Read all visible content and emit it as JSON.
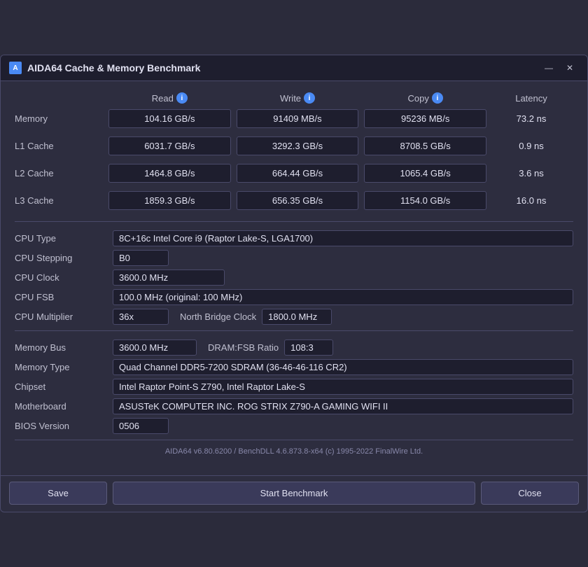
{
  "window": {
    "title": "AIDA64 Cache & Memory Benchmark",
    "minimize_label": "—",
    "close_label": "✕"
  },
  "header": {
    "read_label": "Read",
    "write_label": "Write",
    "copy_label": "Copy",
    "latency_label": "Latency"
  },
  "rows": [
    {
      "label": "Memory",
      "read": "104.16 GB/s",
      "write": "91409 MB/s",
      "copy": "95236 MB/s",
      "latency": "73.2 ns"
    },
    {
      "label": "L1 Cache",
      "read": "6031.7 GB/s",
      "write": "3292.3 GB/s",
      "copy": "8708.5 GB/s",
      "latency": "0.9 ns"
    },
    {
      "label": "L2 Cache",
      "read": "1464.8 GB/s",
      "write": "664.44 GB/s",
      "copy": "1065.4 GB/s",
      "latency": "3.6 ns"
    },
    {
      "label": "L3 Cache",
      "read": "1859.3 GB/s",
      "write": "656.35 GB/s",
      "copy": "1154.0 GB/s",
      "latency": "16.0 ns"
    }
  ],
  "cpu_info": {
    "cpu_type_label": "CPU Type",
    "cpu_type_value": "8C+16c Intel Core i9  (Raptor Lake-S, LGA1700)",
    "cpu_stepping_label": "CPU Stepping",
    "cpu_stepping_value": "B0",
    "cpu_clock_label": "CPU Clock",
    "cpu_clock_value": "3600.0 MHz",
    "cpu_fsb_label": "CPU FSB",
    "cpu_fsb_value": "100.0 MHz  (original: 100 MHz)",
    "cpu_multiplier_label": "CPU Multiplier",
    "cpu_multiplier_value": "36x",
    "north_bridge_label": "North Bridge Clock",
    "north_bridge_value": "1800.0 MHz"
  },
  "memory_info": {
    "memory_bus_label": "Memory Bus",
    "memory_bus_value": "3600.0 MHz",
    "dram_fsb_label": "DRAM:FSB Ratio",
    "dram_fsb_value": "108:3",
    "memory_type_label": "Memory Type",
    "memory_type_value": "Quad Channel DDR5-7200 SDRAM  (36-46-46-116 CR2)",
    "chipset_label": "Chipset",
    "chipset_value": "Intel Raptor Point-S Z790, Intel Raptor Lake-S",
    "motherboard_label": "Motherboard",
    "motherboard_value": "ASUSTeK COMPUTER INC. ROG STRIX Z790-A GAMING WIFI II",
    "bios_label": "BIOS Version",
    "bios_value": "0506"
  },
  "footer_text": "AIDA64 v6.80.6200 / BenchDLL 4.6.873.8-x64  (c) 1995-2022 FinalWire Ltd.",
  "buttons": {
    "save_label": "Save",
    "start_label": "Start Benchmark",
    "close_label": "Close"
  }
}
